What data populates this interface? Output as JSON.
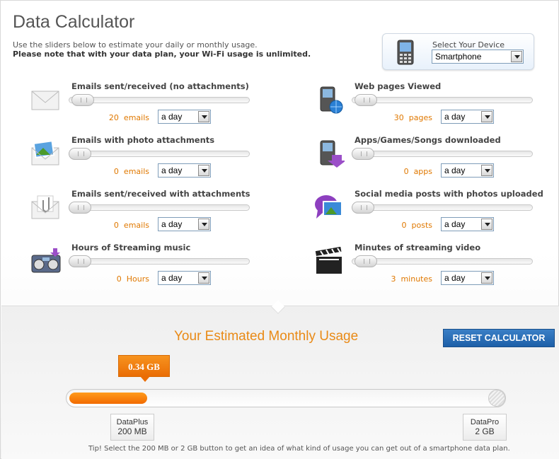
{
  "header": {
    "title": "Data Calculator",
    "intro_line1": "Use the sliders below to estimate your daily or monthly usage.",
    "intro_line2": "Please note that with your data plan, your Wi-Fi usage is unlimited."
  },
  "device": {
    "label": "Select Your Device",
    "selected": "Smartphone"
  },
  "items": [
    {
      "label": "Emails sent/received (no attachments)",
      "value": "20",
      "unit": "emails",
      "period": "a day",
      "icon": "envelope-icon",
      "slider_fraction": 0.02
    },
    {
      "label": "Web pages Viewed",
      "value": "30",
      "unit": "pages",
      "period": "a day",
      "icon": "phone-globe-icon",
      "slider_fraction": 0.02
    },
    {
      "label": "Emails with photo attachments",
      "value": "0",
      "unit": "emails",
      "period": "a day",
      "icon": "photo-envelope-icon",
      "slider_fraction": 0
    },
    {
      "label": "Apps/Games/Songs downloaded",
      "value": "0",
      "unit": "apps",
      "period": "a day",
      "icon": "phone-download-icon",
      "slider_fraction": 0
    },
    {
      "label": "Emails sent/received with attachments",
      "value": "0",
      "unit": "emails",
      "period": "a day",
      "icon": "paperclip-envelope-icon",
      "slider_fraction": 0
    },
    {
      "label": "Social media posts with photos uploaded",
      "value": "0",
      "unit": "posts",
      "period": "a day",
      "icon": "chat-photo-icon",
      "slider_fraction": 0
    },
    {
      "label": "Hours of Streaming music",
      "value": "0",
      "unit": "Hours",
      "period": "a day",
      "icon": "boombox-icon",
      "slider_fraction": 0
    },
    {
      "label": "Minutes of streaming video",
      "value": "3",
      "unit": "minutes",
      "period": "a day",
      "icon": "clapperboard-icon",
      "slider_fraction": 0.02
    }
  ],
  "usage": {
    "title": "Your Estimated Monthly Usage",
    "reset_label": "RESET CALCULATOR",
    "amount": "0.34 GB",
    "fill_fraction": 0.18,
    "plans": [
      {
        "name": "DataPlus",
        "size": "200 MB"
      },
      {
        "name": "DataPro",
        "size": "2 GB"
      }
    ],
    "tip": "Tip! Select the 200 MB or 2 GB button to get an idea of what kind of usage you can get out of a smartphone data plan."
  },
  "colors": {
    "accent_orange": "#f26a00",
    "reset_blue": "#1d5fa8"
  }
}
